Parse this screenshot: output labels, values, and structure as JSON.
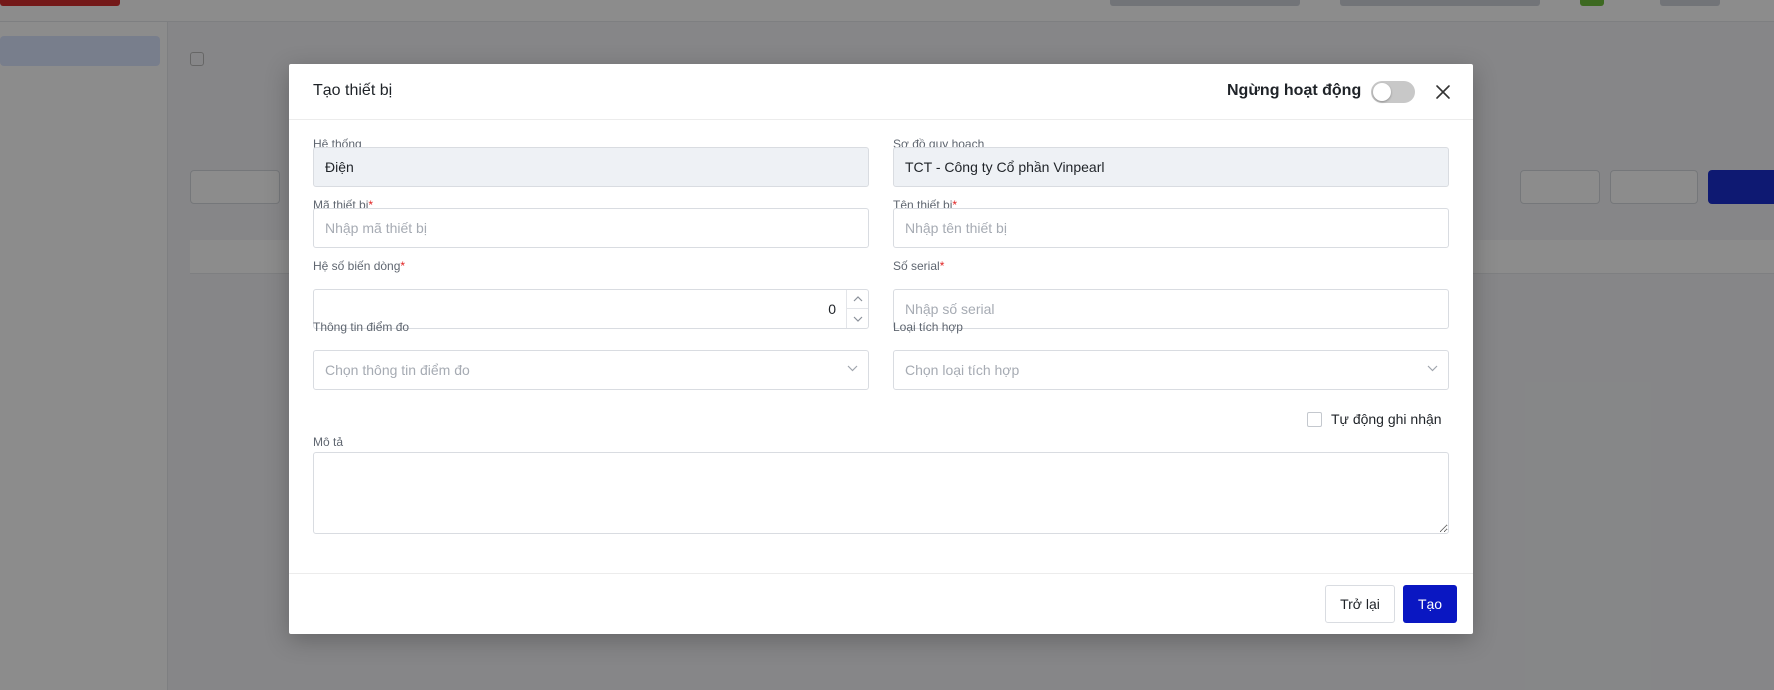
{
  "modal": {
    "title": "Tạo thiết bị",
    "status_label": "Ngừng hoạt động",
    "status_toggle_on": false
  },
  "form": {
    "system": {
      "label": "Hệ thống",
      "value": "Điện"
    },
    "plan_diagram": {
      "label": "Sơ đồ quy hoạch",
      "value": "TCT - Công ty Cổ phần Vinpearl"
    },
    "device_code": {
      "label": "Mã thiết bị",
      "required_mark": "*",
      "value": "",
      "placeholder": "Nhập mã thiết bị"
    },
    "device_name": {
      "label": "Tên thiết bị",
      "required_mark": "*",
      "value": "",
      "placeholder": "Nhập tên thiết bị"
    },
    "transform_ratio": {
      "label": "Hệ số biến dòng",
      "required_mark": "*",
      "value": "0"
    },
    "serial_number": {
      "label": "Số serial",
      "required_mark": "*",
      "value": "",
      "placeholder": "Nhập số serial"
    },
    "measure_point": {
      "label": "Thông tin điểm đo",
      "placeholder": "Chọn thông tin điểm đo"
    },
    "integration_type": {
      "label": "Loại tích hợp",
      "placeholder": "Chọn loại tích hợp"
    },
    "auto_record": {
      "label": "Tự động ghi nhận",
      "checked": false
    },
    "description": {
      "label": "Mô tả",
      "value": ""
    }
  },
  "footer": {
    "back_label": "Trở lại",
    "create_label": "Tạo"
  },
  "colors": {
    "primary": "#0a17c2",
    "required": "#e02424",
    "toggle_off": "#c8c8c8",
    "readonly_bg": "#eef1f5"
  },
  "icons": {
    "close": "close-icon",
    "chevron": "chevron-down-icon",
    "stepper_up": "chevron-up-icon",
    "stepper_down": "chevron-down-icon"
  }
}
